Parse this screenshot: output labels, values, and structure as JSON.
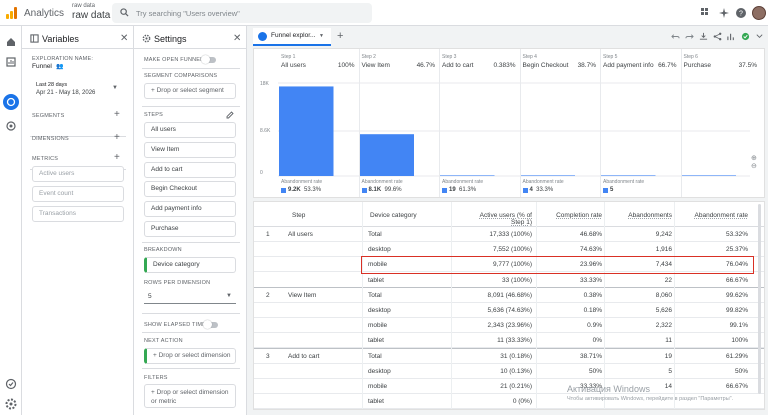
{
  "header": {
    "app_name": "Analytics",
    "property_sub": "raw data",
    "property_main": "raw data",
    "search_placeholder": "Try searching \"Users overview\""
  },
  "variables": {
    "title": "Variables",
    "exploration_name_label": "EXPLORATION NAME:",
    "exploration_name": "Funnel",
    "date_label": "Last 28 days",
    "date_range": "Apr 21 - May 18, 2026",
    "segments_label": "SEGMENTS",
    "dimensions_label": "DIMENSIONS",
    "metrics_label": "METRICS",
    "metrics": [
      "Active users",
      "Event count",
      "Transactions"
    ]
  },
  "settings": {
    "title": "Settings",
    "make_open_funnel": "MAKE OPEN FUNNEL",
    "segment_comparisons": "SEGMENT COMPARISONS",
    "drop_segment": "Drop or select segment",
    "steps_label": "STEPS",
    "steps": [
      "All users",
      "View Item",
      "Add to cart",
      "Begin Checkout",
      "Add payment info",
      "Purchase"
    ],
    "breakdown_label": "BREAKDOWN",
    "breakdown_value": "Device category",
    "rows_per_dimension_label": "ROWS PER DIMENSION",
    "rows_per_dimension": "5",
    "show_elapsed_time": "SHOW ELAPSED TIME",
    "next_action_label": "NEXT ACTION",
    "drop_dimension": "Drop or select dimension",
    "filters_label": "FILTERS",
    "drop_dimension_metric": "Drop or select dimension or metric"
  },
  "canvas": {
    "tab_label": "Funnel explor...",
    "chart_data": {
      "type": "bar",
      "categories": [
        "All users",
        "View Item",
        "Add to cart",
        "Begin Checkout",
        "Add payment info",
        "Purchase"
      ],
      "step_numbers": [
        "Step 1",
        "Step 2",
        "Step 3",
        "Step 4",
        "Step 5",
        "Step 6"
      ],
      "step_pcts": [
        "100%",
        "46.7%",
        "0.383%",
        "38.7%",
        "66.7%",
        "37.5%"
      ],
      "values": [
        17333,
        8091,
        31,
        12,
        8,
        3
      ],
      "ylim": [
        0,
        18000
      ],
      "yticks": [
        "18K",
        "8.6K",
        "0"
      ],
      "abandonment_label": "Abandonment rate",
      "abandonment_counts": [
        "9.2K",
        "8.1K",
        "19",
        "4",
        "5",
        ""
      ],
      "abandonment_rates": [
        "53.3%",
        "99.6%",
        "61.3%",
        "33.3%",
        "",
        ""
      ],
      "bar_color": "#4285f4"
    },
    "table": {
      "headers": [
        "Step",
        "Device category",
        "Active users (% of Step 1)",
        "Completion rate",
        "Abandonments",
        "Abandonment rate"
      ],
      "rows": [
        {
          "num": "1",
          "step": "All users",
          "device": "Total",
          "users": "17,333 (100%)",
          "completion": "46.68%",
          "abandonments": "9,242",
          "rate": "53.32%"
        },
        {
          "num": "",
          "step": "",
          "device": "desktop",
          "users": "7,552 (100%)",
          "completion": "74.63%",
          "abandonments": "1,916",
          "rate": "25.37%"
        },
        {
          "num": "",
          "step": "",
          "device": "mobile",
          "users": "9,777 (100%)",
          "completion": "23.96%",
          "abandonments": "7,434",
          "rate": "76.04%"
        },
        {
          "num": "",
          "step": "",
          "device": "tablet",
          "users": "33 (100%)",
          "completion": "33.33%",
          "abandonments": "22",
          "rate": "66.67%"
        },
        {
          "num": "2",
          "step": "View Item",
          "device": "Total",
          "users": "8,091 (46.68%)",
          "completion": "0.38%",
          "abandonments": "8,060",
          "rate": "99.62%"
        },
        {
          "num": "",
          "step": "",
          "device": "desktop",
          "users": "5,636 (74.63%)",
          "completion": "0.18%",
          "abandonments": "5,626",
          "rate": "99.82%"
        },
        {
          "num": "",
          "step": "",
          "device": "mobile",
          "users": "2,343 (23.96%)",
          "completion": "0.9%",
          "abandonments": "2,322",
          "rate": "99.1%"
        },
        {
          "num": "",
          "step": "",
          "device": "tablet",
          "users": "11 (33.33%)",
          "completion": "0%",
          "abandonments": "11",
          "rate": "100%"
        },
        {
          "num": "3",
          "step": "Add to cart",
          "device": "Total",
          "users": "31 (0.18%)",
          "completion": "38.71%",
          "abandonments": "19",
          "rate": "61.29%"
        },
        {
          "num": "",
          "step": "",
          "device": "desktop",
          "users": "10 (0.13%)",
          "completion": "50%",
          "abandonments": "5",
          "rate": "50%"
        },
        {
          "num": "",
          "step": "",
          "device": "mobile",
          "users": "21 (0.21%)",
          "completion": "33.33%",
          "abandonments": "14",
          "rate": "66.67%"
        },
        {
          "num": "",
          "step": "",
          "device": "tablet",
          "users": "0 (0%)",
          "completion": "",
          "abandonments": "",
          "rate": ""
        }
      ]
    }
  },
  "watermark": {
    "line1": "Активация Windows",
    "line2": "Чтобы активировать Windows, перейдите в раздел \"Параметры\"."
  },
  "colors": {
    "accent": "#1a73e8",
    "highlight": "#d93025",
    "breakdown": "#34a853"
  }
}
